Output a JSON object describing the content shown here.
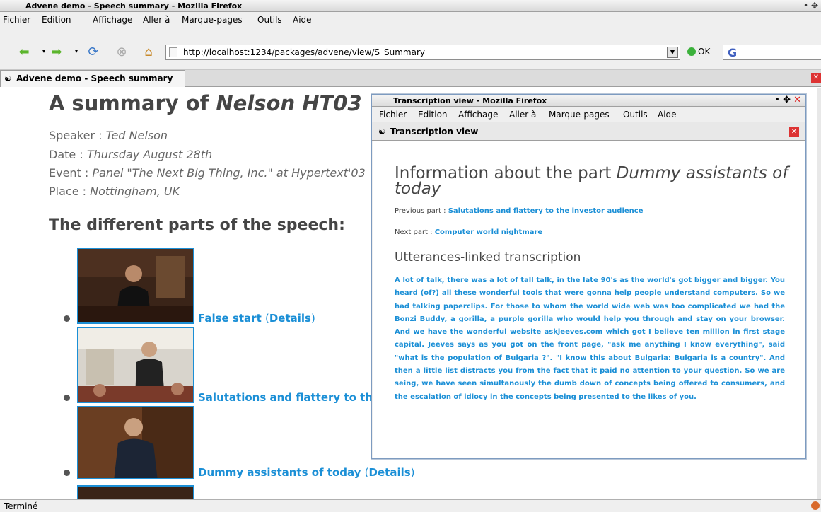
{
  "window": {
    "title": "Advene demo - Speech summary - Mozilla Firefox",
    "menu": [
      "Fichier",
      "Edition",
      "Affichage",
      "Aller à",
      "Marque-pages",
      "Outils",
      "Aide"
    ],
    "url": "http://localhost:1234/packages/advene/view/S_Summary",
    "ok_label": "OK",
    "search_logo": "G",
    "tab_label": "Advene demo - Speech summary",
    "status": "Terminé"
  },
  "page": {
    "title_prefix": "A summary of",
    "title_subject": "Nelson HT03",
    "meta": [
      {
        "label": "Speaker : ",
        "value": "Ted Nelson"
      },
      {
        "label": "Date : ",
        "value": "Thursday August 28th"
      },
      {
        "label": "Event : ",
        "value": "Panel \"The Next Big Thing, Inc.\" at Hypertext'03"
      },
      {
        "label": "Place : ",
        "value": "Nottingham, UK"
      }
    ],
    "parts_heading": "The different parts of the speech:",
    "parts": [
      {
        "title": "False start",
        "details": "Details"
      },
      {
        "title": "Salutations and flattery to the i",
        "details": ""
      },
      {
        "title": "Dummy assistants of today",
        "details": "Details"
      }
    ]
  },
  "popup": {
    "title": "Transcription view - Mozilla Firefox",
    "menu": [
      "Fichier",
      "Edition",
      "Affichage",
      "Aller à",
      "Marque-pages",
      "Outils",
      "Aide"
    ],
    "tab_label": "Transcription view",
    "heading_prefix": "Information about the part",
    "heading_part": "Dummy assistants of today",
    "previous_label": "Previous part : ",
    "previous_link": "Salutations and flattery to the investor audience",
    "next_label": "Next part : ",
    "next_link": "Computer world nightmare",
    "transcription_heading": "Utterances-linked transcription",
    "transcription": "A lot of talk, there was a lot of tall talk, in the late 90's as the world's got bigger and bigger. You heard (of?) all these wonderful tools that were gonna help people understand computers. So we had talking paperclips. For those to whom the world wide web was too complicated we had the Bonzi Buddy, a gorilla, a purple gorilla who would help you through and stay on your browser. And we have the wonderful website askjeeves.com which got I believe ten million in first stage capital. Jeeves says as you got on the front page, \"ask me anything I know everything\", said \"what is the population of Bulgaria ?\". \"I know this about Bulgaria: Bulgaria is a country\". And then a little list distracts you from the fact that it paid no attention to your question. So we are seing, we have seen simultanously the dumb down of concepts being offered to consumers, and the escalation of idiocy in the concepts being presented to the likes of you."
  },
  "colors": {
    "link": "#1b8fd6",
    "heading": "#454545",
    "close": "#dd3333"
  }
}
